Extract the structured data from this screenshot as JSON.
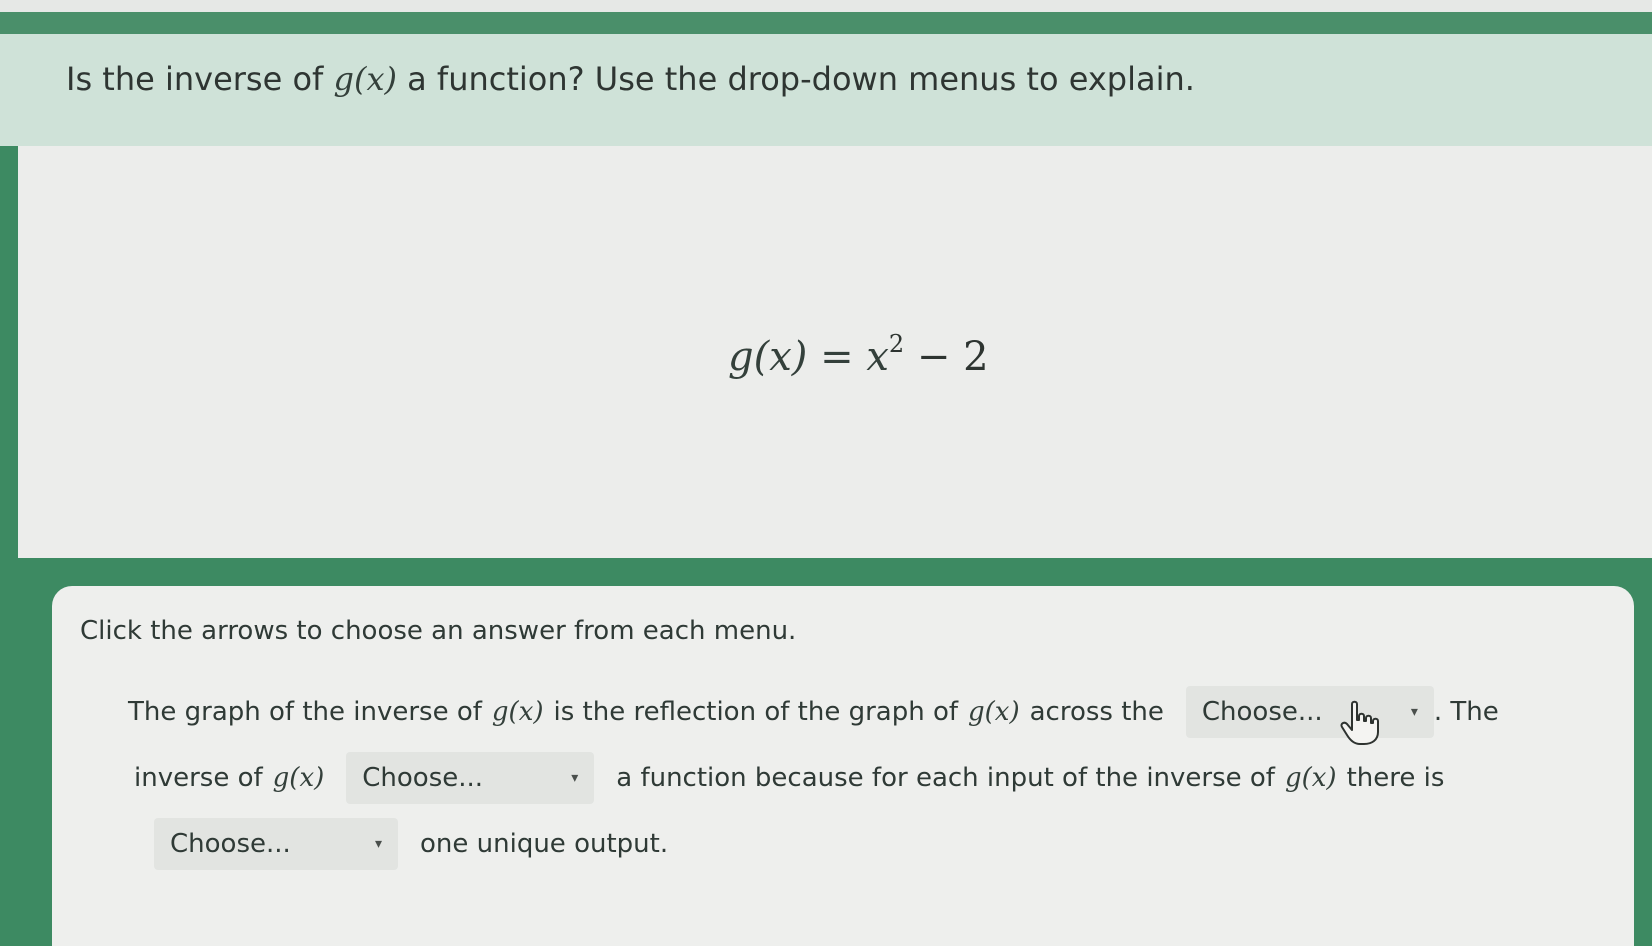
{
  "question": {
    "prefix": "Is the inverse of",
    "func": "g(x)",
    "suffix": "a function? Use the drop-down menus to explain."
  },
  "equation": {
    "lhs": "g(x) = x",
    "exponent": "2",
    "rhs": " − 2"
  },
  "instructions": "Click the arrows to choose an answer from each menu.",
  "sentence": {
    "part1": "The graph of the inverse of",
    "func": "g(x)",
    "part2": "is the reflection of the graph of",
    "part3": "across the",
    "part4": ". The",
    "part5": "inverse of",
    "part6": "a function because for each input of the inverse of",
    "part7": "there is",
    "part8": "one unique output."
  },
  "dropdowns": {
    "axis": {
      "selected": "Choose..."
    },
    "is_function": {
      "selected": "Choose..."
    },
    "count": {
      "selected": "Choose..."
    }
  },
  "icons": {
    "caret": "▾",
    "cursor": "hand-pointer-icon"
  },
  "colors": {
    "accent_green": "#3d8a62",
    "band": "#cfe2d8",
    "panel": "#ecedeb",
    "dropdown": "#e2e4e1"
  }
}
